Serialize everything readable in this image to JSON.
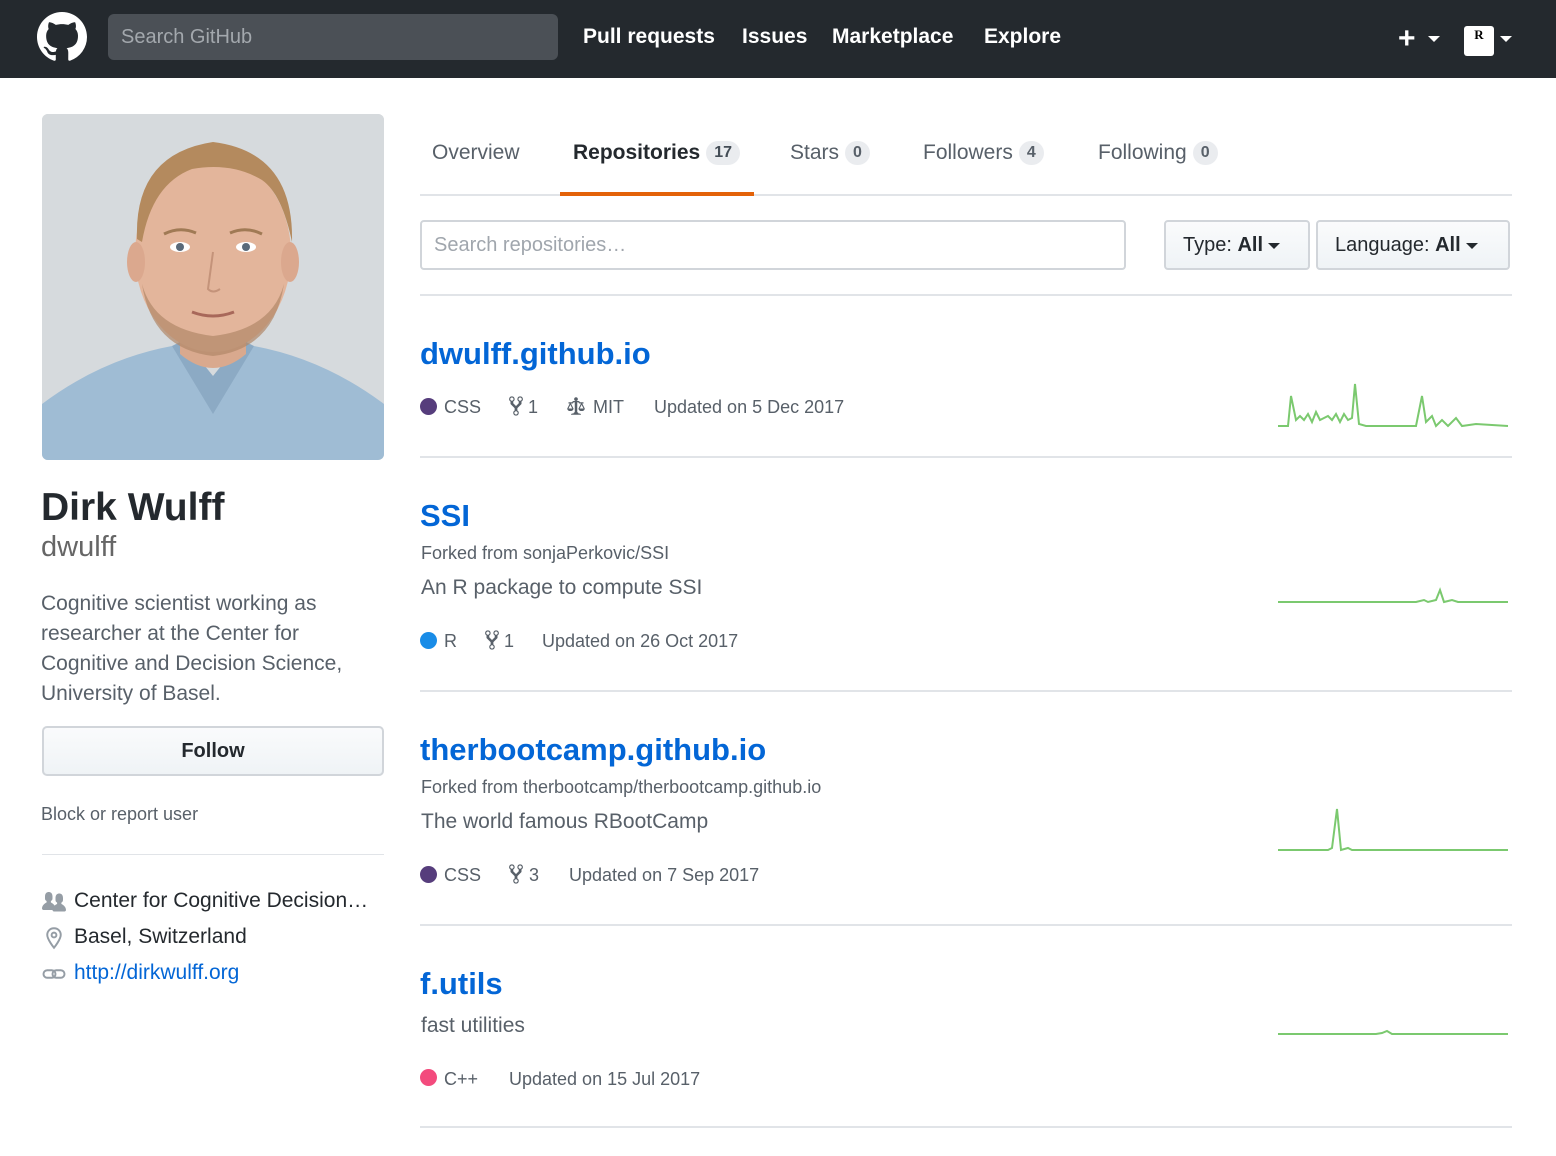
{
  "header": {
    "search_placeholder": "Search GitHub",
    "nav": [
      "Pull requests",
      "Issues",
      "Marketplace",
      "Explore"
    ],
    "plus_label": "+",
    "avatar_text": "R"
  },
  "profile": {
    "fullname": "Dirk Wulff",
    "username": "dwulff",
    "bio": "Cognitive scientist working as researcher at the Center for Cognitive and Decision Science, University of Basel.",
    "follow_label": "Follow",
    "block_label": "Block or report user",
    "organization": "Center for Cognitive Decision…",
    "location": "Basel, Switzerland",
    "website": "http://dirkwulff.org"
  },
  "tabs": [
    {
      "label": "Overview"
    },
    {
      "label": "Repositories",
      "count": "17"
    },
    {
      "label": "Stars",
      "count": "0"
    },
    {
      "label": "Followers",
      "count": "4"
    },
    {
      "label": "Following",
      "count": "0"
    }
  ],
  "filters": {
    "search_placeholder": "Search repositories…",
    "type_label": "Type:",
    "type_value": "All",
    "language_label": "Language:",
    "language_value": "All"
  },
  "repos": [
    {
      "name": "dwulff.github.io",
      "language": "CSS",
      "language_color": "#563d7c",
      "forks": "1",
      "license": "MIT",
      "updated": "Updated on 5 Dec 2017"
    },
    {
      "name": "SSI",
      "forked_from": "Forked from sonjaPerkovic/SSI",
      "description": "An R package to compute SSI",
      "language": "R",
      "language_color": "#198ce7",
      "forks": "1",
      "updated": "Updated on 26 Oct 2017"
    },
    {
      "name": "therbootcamp.github.io",
      "forked_from": "Forked from therbootcamp/therbootcamp.github.io",
      "description": "The world famous RBootCamp",
      "language": "CSS",
      "language_color": "#563d7c",
      "forks": "3",
      "updated": "Updated on 7 Sep 2017"
    },
    {
      "name": "f.utils",
      "description": "fast utilities",
      "language": "C++",
      "language_color": "#f34b7d",
      "updated": "Updated on 15 Jul 2017"
    }
  ],
  "colors": {
    "header_bg": "#24292e",
    "link": "#0366d6",
    "tab_accent": "#e36209",
    "sparkline": "#7bc96f"
  }
}
